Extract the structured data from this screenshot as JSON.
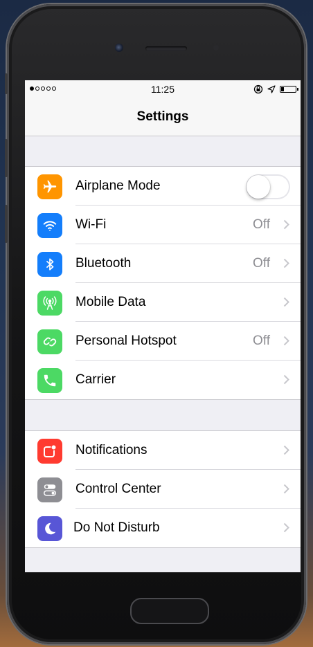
{
  "status_bar": {
    "signal_dots_filled": 1,
    "signal_dots_total": 5,
    "time": "11:25",
    "battery_level": 0.2
  },
  "nav": {
    "title": "Settings"
  },
  "groups": [
    {
      "rows": [
        {
          "label": "Airplane Mode",
          "icon": "airplane-icon",
          "icon_color": "#ff9500",
          "control": "toggle",
          "toggle_on": false
        },
        {
          "label": "Wi-Fi",
          "icon": "wifi-icon",
          "icon_color": "#147efb",
          "value": "Off",
          "control": "chevron"
        },
        {
          "label": "Bluetooth",
          "icon": "bluetooth-icon",
          "icon_color": "#147efb",
          "value": "Off",
          "control": "chevron"
        },
        {
          "label": "Mobile Data",
          "icon": "antenna-icon",
          "icon_color": "#4cd964",
          "control": "chevron"
        },
        {
          "label": "Personal Hotspot",
          "icon": "hotspot-icon",
          "icon_color": "#4cd964",
          "value": "Off",
          "control": "chevron"
        },
        {
          "label": "Carrier",
          "icon": "phone-icon",
          "icon_color": "#4cd964",
          "control": "chevron"
        }
      ]
    },
    {
      "rows": [
        {
          "label": "Notifications",
          "icon": "notifications-icon",
          "icon_color": "#ff3b30",
          "control": "chevron"
        },
        {
          "label": "Control Center",
          "icon": "control-center-icon",
          "icon_color": "#8e8e93",
          "control": "chevron"
        },
        {
          "label": "Do Not Disturb",
          "icon": "moon-icon",
          "icon_color": "#5856d6",
          "control": "chevron"
        }
      ]
    }
  ]
}
